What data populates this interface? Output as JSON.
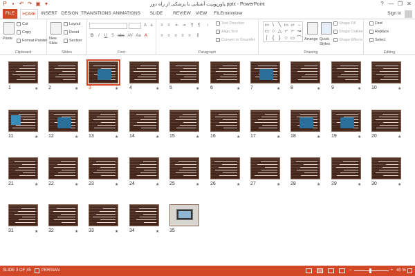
{
  "titlebar": {
    "title": "پاورپوینت آشنایی با پزشکی از راه دور.pptx - PowerPoint",
    "qat_icons": [
      "powerpoint-logo-icon",
      "save-icon",
      "undo-icon",
      "redo-icon",
      "start-presentation-icon",
      "customize-qat-icon"
    ],
    "window_controls": [
      "?",
      "—",
      "❐",
      "✕"
    ]
  },
  "tabs": {
    "items": [
      "FILE",
      "HOME",
      "INSERT",
      "DESIGN",
      "TRANSITIONS",
      "ANIMATIONS",
      "SLIDE SHOW",
      "REVIEW",
      "VIEW",
      "FILEminimizer"
    ],
    "active": "HOME",
    "signin": "Sign in"
  },
  "ribbon": {
    "clipboard": {
      "paste": "Paste",
      "cut": "Cut",
      "copy": "Copy",
      "format_painter": "Format Painter",
      "label": "Clipboard"
    },
    "slides": {
      "new_slide": "New Slide",
      "layout": "Layout",
      "reset": "Reset",
      "section": "Section",
      "label": "Slides"
    },
    "font": {
      "label": "Font",
      "buttons": [
        "B",
        "I",
        "U",
        "S",
        "abc",
        "AV",
        "Aa",
        "A"
      ]
    },
    "paragraph": {
      "text_direction": "Text Direction",
      "align_text": "Align Text",
      "convert_smartart": "Convert to SmartArt",
      "label": "Paragraph"
    },
    "drawing": {
      "shapes": [
        "▭",
        "\\",
        "╲",
        "▭",
        "▱",
        "→",
        "▭",
        "○",
        "△",
        "⌐",
        "⌐",
        "↝",
        "⎰",
        "{",
        "}",
        "☆",
        "▭",
        "⌒"
      ],
      "arrange": "Arrange",
      "quick_styles": "Quick Styles",
      "shape_fill": "Shape Fill",
      "shape_outline": "Shape Outline",
      "shape_effects": "Shape Effects",
      "label": "Drawing"
    },
    "editing": {
      "find": "Find",
      "replace": "Replace",
      "select": "Select",
      "label": "Editing"
    }
  },
  "slides": {
    "selected": 3,
    "items": [
      {
        "num": "1",
        "star": "★"
      },
      {
        "num": "2",
        "star": "★"
      },
      {
        "num": "3",
        "star": "★"
      },
      {
        "num": "4",
        "star": "★"
      },
      {
        "num": "5",
        "star": "★"
      },
      {
        "num": "6",
        "star": "★"
      },
      {
        "num": "7",
        "star": "★"
      },
      {
        "num": "8",
        "star": "★"
      },
      {
        "num": "9",
        "star": "★"
      },
      {
        "num": "10",
        "star": "★"
      },
      {
        "num": "11",
        "star": "★"
      },
      {
        "num": "12",
        "star": "★"
      },
      {
        "num": "13",
        "star": "★"
      },
      {
        "num": "14",
        "star": "★"
      },
      {
        "num": "15",
        "star": "★"
      },
      {
        "num": "16",
        "star": "★"
      },
      {
        "num": "17",
        "star": "★"
      },
      {
        "num": "18",
        "star": "★"
      },
      {
        "num": "19",
        "star": "★"
      },
      {
        "num": "20",
        "star": "★"
      },
      {
        "num": "21",
        "star": "★"
      },
      {
        "num": "22",
        "star": "★"
      },
      {
        "num": "23",
        "star": "★"
      },
      {
        "num": "24",
        "star": "★"
      },
      {
        "num": "25",
        "star": "★"
      },
      {
        "num": "26",
        "star": "★"
      },
      {
        "num": "27",
        "star": "★"
      },
      {
        "num": "28",
        "star": "★"
      },
      {
        "num": "29",
        "star": "★"
      },
      {
        "num": "30",
        "star": "★"
      },
      {
        "num": "31",
        "star": "★"
      },
      {
        "num": "32",
        "star": "★"
      },
      {
        "num": "33",
        "star": "★"
      },
      {
        "num": "34",
        "star": "★"
      },
      {
        "num": "35",
        "star": ""
      }
    ]
  },
  "statusbar": {
    "slide_info": "SLIDE 3 OF 35",
    "language": "PERSIAN",
    "zoom": "40 %",
    "zoom_level": 40,
    "accent": "#d24726"
  }
}
